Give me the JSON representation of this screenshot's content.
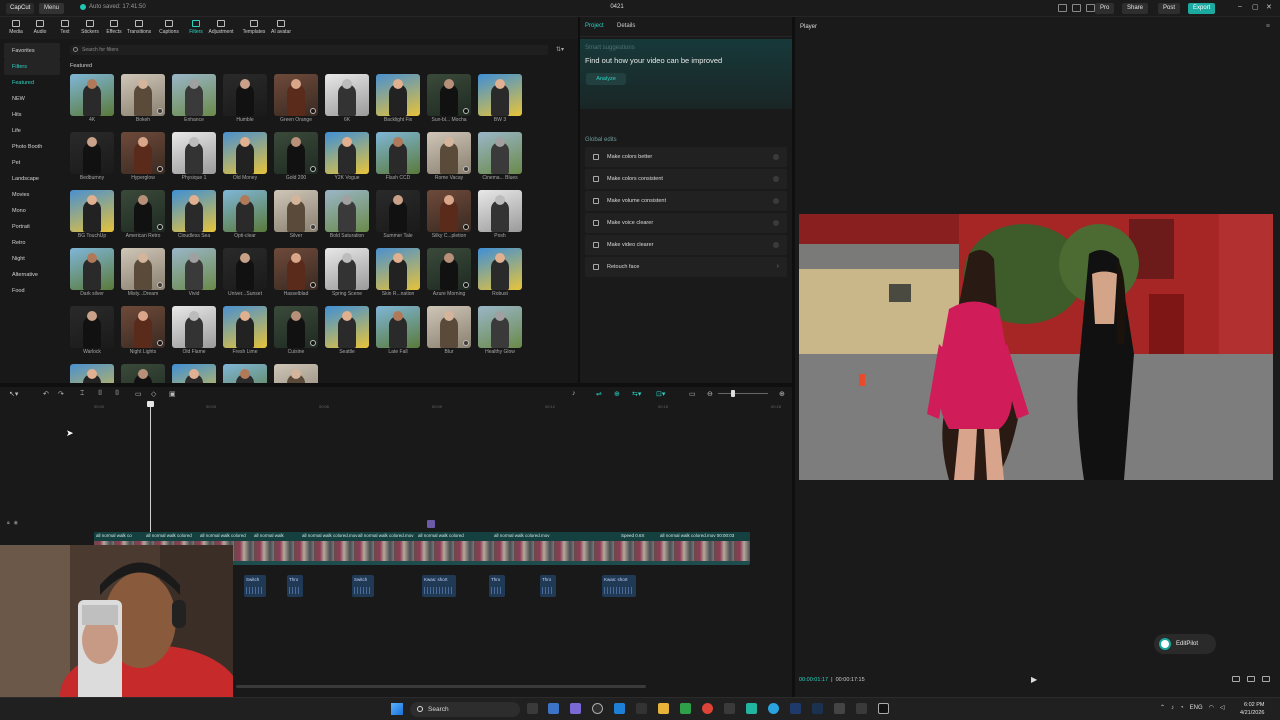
{
  "topbar": {
    "logo": "CapCut",
    "menu": "Menu",
    "autosave": "Auto saved: 17:41:50",
    "project_title": "0421",
    "pro": "Pro",
    "share": "Share",
    "post": "Post",
    "export": "Export"
  },
  "tools": [
    {
      "label": "Media",
      "icon": "media-icon"
    },
    {
      "label": "Audio",
      "icon": "audio-icon"
    },
    {
      "label": "Text",
      "icon": "text-icon"
    },
    {
      "label": "Stickers",
      "icon": "stickers-icon"
    },
    {
      "label": "Effects",
      "icon": "effects-icon"
    },
    {
      "label": "Transitions",
      "icon": "transitions-icon"
    },
    {
      "label": "Captions",
      "icon": "captions-icon"
    },
    {
      "label": "Filters",
      "icon": "filters-icon",
      "active": true
    },
    {
      "label": "Adjustment",
      "icon": "adjustment-icon"
    },
    {
      "label": "Templates",
      "icon": "templates-icon"
    },
    {
      "label": "AI avatar",
      "icon": "ai-avatar-icon"
    }
  ],
  "sidebar": {
    "favorites": "Favorites",
    "filters": "Filters",
    "categories": [
      "Featured",
      "NEW",
      "Hits",
      "Life",
      "Photo Booth",
      "Pet",
      "Landscape",
      "Movies",
      "Mono",
      "Portrait",
      "Retro",
      "Night",
      "Alternative",
      "Food"
    ]
  },
  "search": {
    "placeholder": "Search for filters"
  },
  "section_label": "Featured",
  "filters": [
    "4K",
    "Bokeh",
    "Enhance",
    "Humble",
    "Green Orange",
    "6K",
    "Backlight Fix",
    "Sun-bl... Mocha",
    "BW 3",
    "Bedburnny",
    "Hyperglow",
    "Physique 1",
    "Old Money",
    "Gold 200",
    "Y2K Vogue",
    "Flash CCD",
    "Rome Vacay",
    "Cinema... Blues",
    "BG TouchUp",
    "American Retro",
    "Cloudless Sea",
    "Opti-clear",
    "Silver",
    "Bold Saturation",
    "Summer Tale",
    "Silky C...pletion",
    "Posh",
    "Dark silver",
    "Misty...Dream",
    "Vivid",
    "Univer...Sunset",
    "Hasselblad",
    "Spring Scene",
    "Skin R...nation",
    "Azure Morning",
    "Robust",
    "Warlock",
    "Night Lights",
    "Old Flame",
    "Fresh Lime",
    "Cuisine",
    "Seattle",
    "Late Fall",
    "Blur",
    "Healthy Glow",
    "",
    "",
    "",
    "",
    ""
  ],
  "right_panel": {
    "tab_project": "Project",
    "tab_details": "Details",
    "smart_title": "Smart suggestions",
    "smart_sub": "Find out how your video can be improved",
    "analyze": "Analyze",
    "global_edits": "Global edits",
    "edits": [
      {
        "label": "Make colors better",
        "icon": "wand-icon"
      },
      {
        "label": "Make colors consistent",
        "icon": "palette-icon"
      },
      {
        "label": "Make volume consistent",
        "icon": "volume-icon"
      },
      {
        "label": "Make voice clearer",
        "icon": "voice-icon"
      },
      {
        "label": "Make video clearer",
        "icon": "hd-icon"
      },
      {
        "label": "Retouch face",
        "icon": "face-icon"
      }
    ]
  },
  "player": {
    "title": "Player",
    "current_time": "00:00:01:17",
    "total_time": "00:00:17:15",
    "editpilot": "EditPilot"
  },
  "timeline": {
    "ruler": [
      "00:00",
      "00:03",
      "00:06",
      "00:09",
      "00:12",
      "00:15",
      "00:18"
    ],
    "clips": [
      "all normal walk co",
      "all normal walk colored",
      "all normal walk colored",
      "all normal walk",
      "all normal walk colored.mov",
      "all normal walk colored.mov",
      "all normal walk colored",
      "all normal walk colored.mov",
      "Speed 0.6X",
      "all normal walk colored.mov 00:00:03"
    ],
    "audio": [
      "Switch",
      "Thro",
      "Switch",
      "Kwas: short",
      "Thro",
      "Thro",
      "Kwas: short"
    ]
  },
  "taskbar": {
    "search": "Search",
    "lang": "ENG",
    "time": "6:02 PM",
    "date": "4/21/2026"
  },
  "colors": {
    "accent": "#2ad4c4",
    "export": "#1ba9a0"
  }
}
